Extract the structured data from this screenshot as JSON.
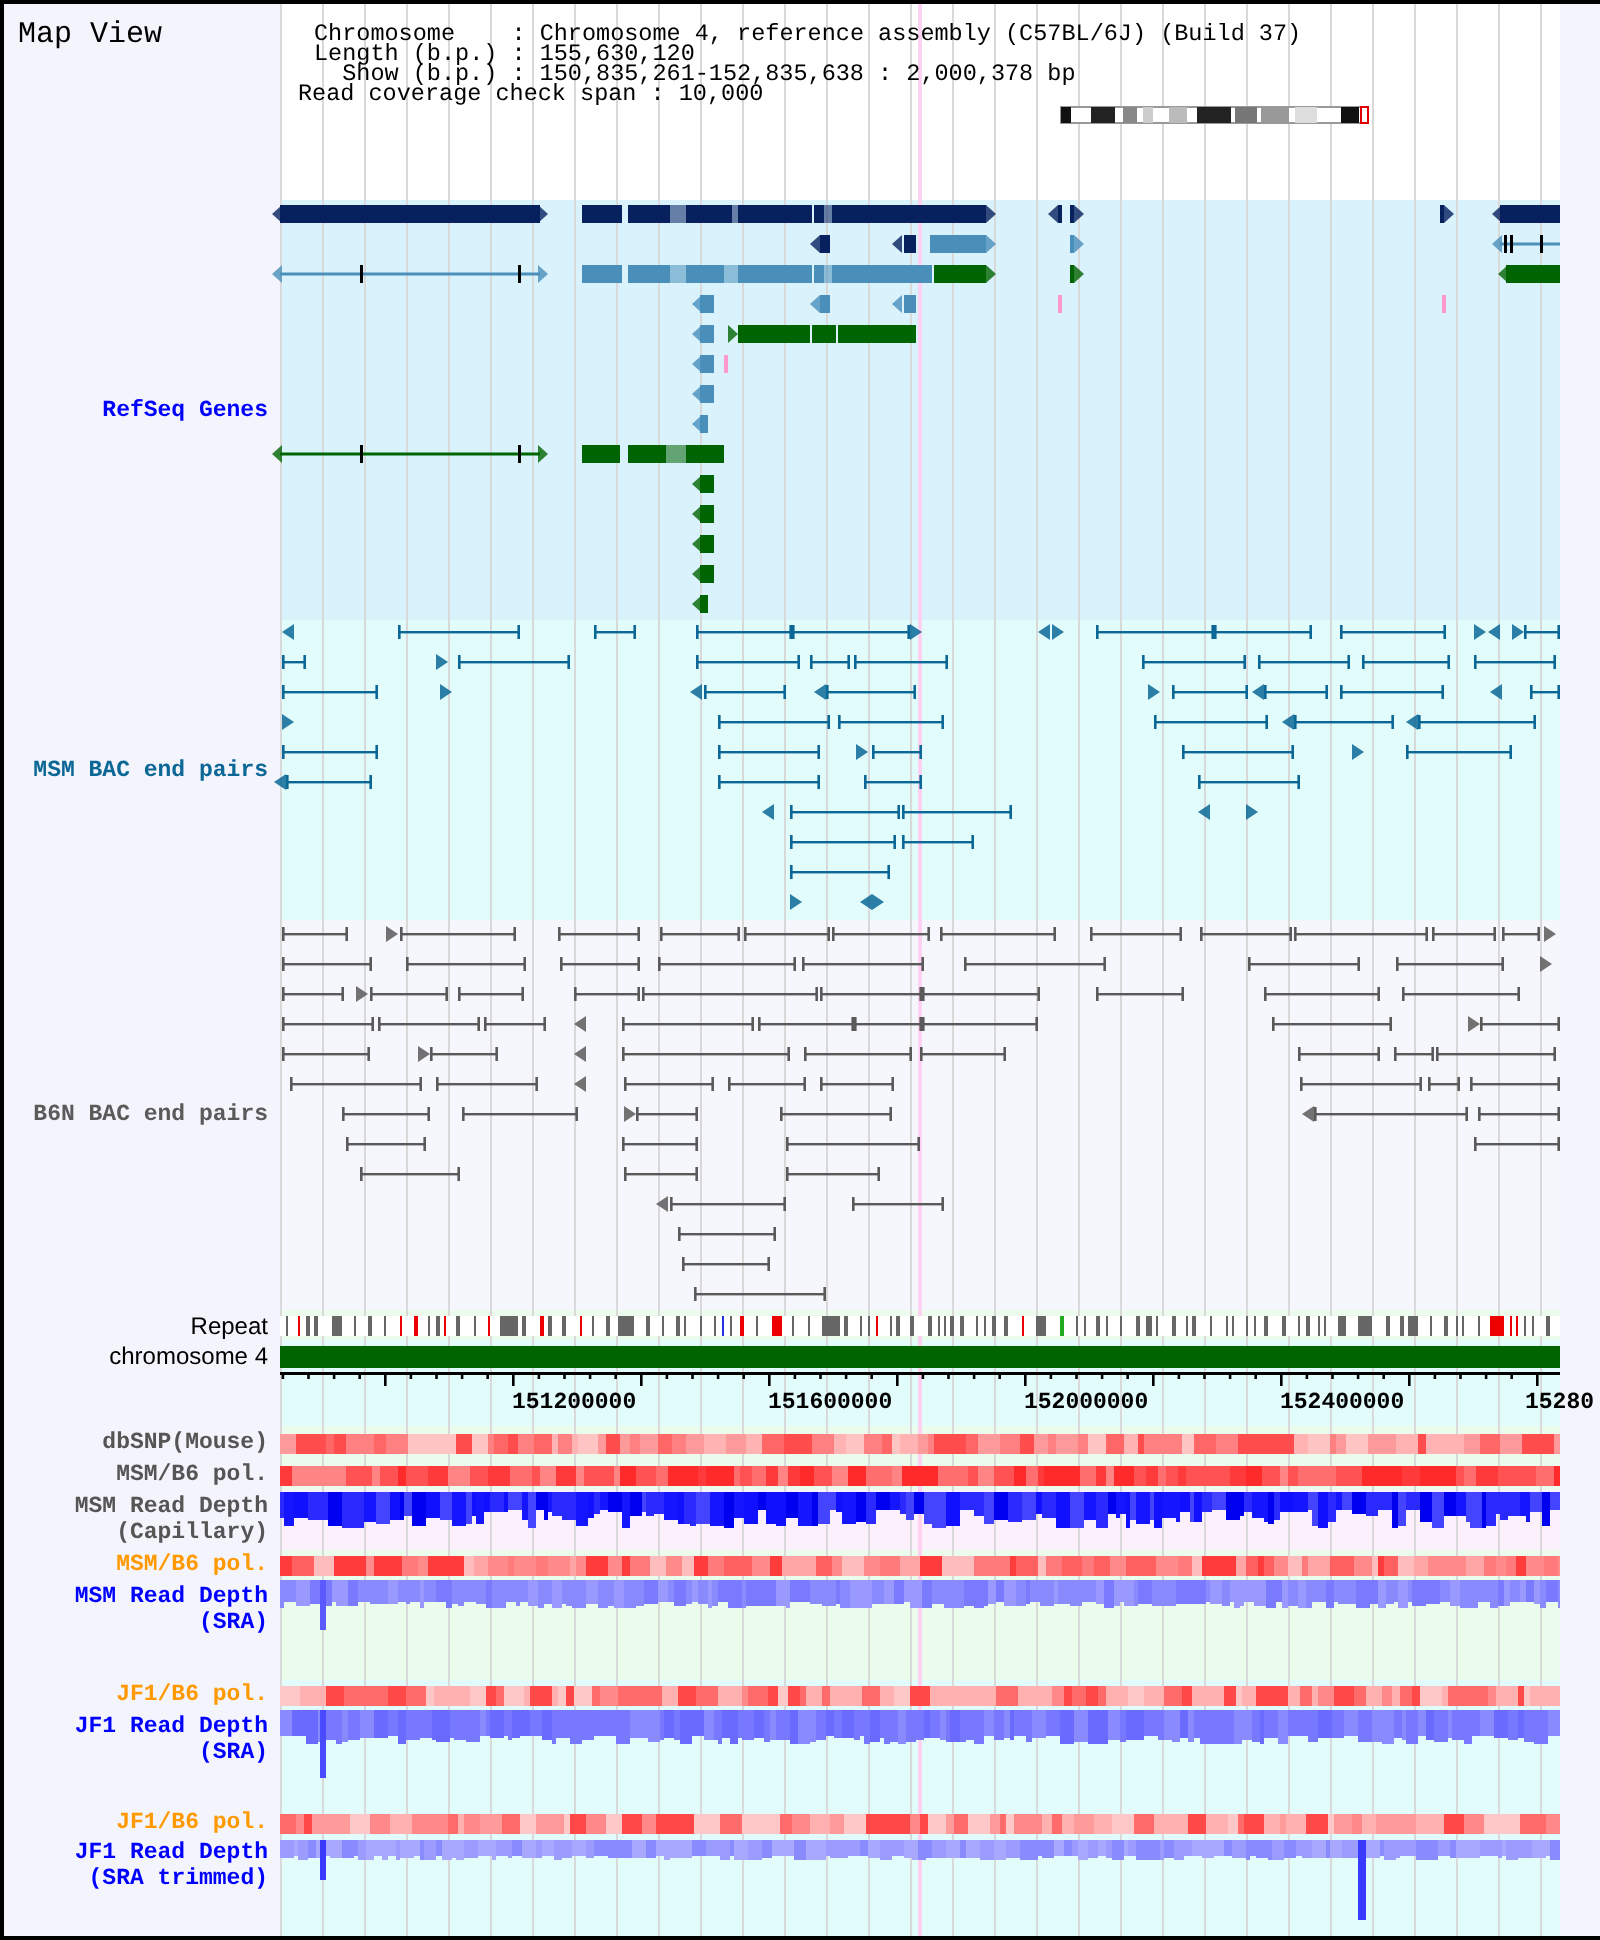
{
  "title": "Map View",
  "header": {
    "lines": [
      "Chromosome    : Chromosome 4, reference assembly (C57BL/6J) (Build 37)",
      "Length (b.p.) : 155,630,120",
      "Show (b.p.) : 150,835,261-152,835,638 : 2,000,378 bp",
      "Read coverage check span : 10,000"
    ]
  },
  "feature_tracks": [
    {
      "label": "RefSeq Genes",
      "kind": "genes",
      "color": "#0000ff"
    },
    {
      "label": "MSM BAC end pairs",
      "kind": "bac_msm",
      "color": "#0a6796"
    },
    {
      "label": "B6N BAC end pairs",
      "kind": "bac_b6n",
      "color": "#5a5a5a"
    }
  ],
  "annotation_tracks": [
    {
      "label": "Repeat",
      "kind": "repeat"
    },
    {
      "label": "chromosome 4",
      "kind": "chromosome"
    }
  ],
  "ruler": {
    "labels": [
      "151200000",
      "151600000",
      "152000000",
      "152400000",
      "15280"
    ]
  },
  "data_tracks": [
    {
      "label": "dbSNP(Mouse)",
      "kind": "snp",
      "color": "#555555"
    },
    {
      "label": "MSM/B6 pol.",
      "kind": "polymorphism",
      "color": "#555555"
    },
    {
      "label": "MSM Read Depth (Capillary)",
      "kind": "depth",
      "color": "#555555"
    },
    {
      "label": "MSM/B6 pol.",
      "kind": "polymorphism",
      "color": "#ff9900"
    },
    {
      "label": "MSM Read Depth (SRA)",
      "kind": "depth",
      "color": "#0000ff"
    },
    {
      "label": "JF1/B6 pol.",
      "kind": "polymorphism",
      "color": "#ff9900"
    },
    {
      "label": "JF1 Read Depth (SRA)",
      "kind": "depth",
      "color": "#0000ff"
    },
    {
      "label": "JF1/B6 pol.",
      "kind": "polymorphism",
      "color": "#ff9900"
    },
    {
      "label": "JF1 Read Depth (SRA trimmed)",
      "kind": "depth",
      "color": "#0000ff"
    }
  ]
}
